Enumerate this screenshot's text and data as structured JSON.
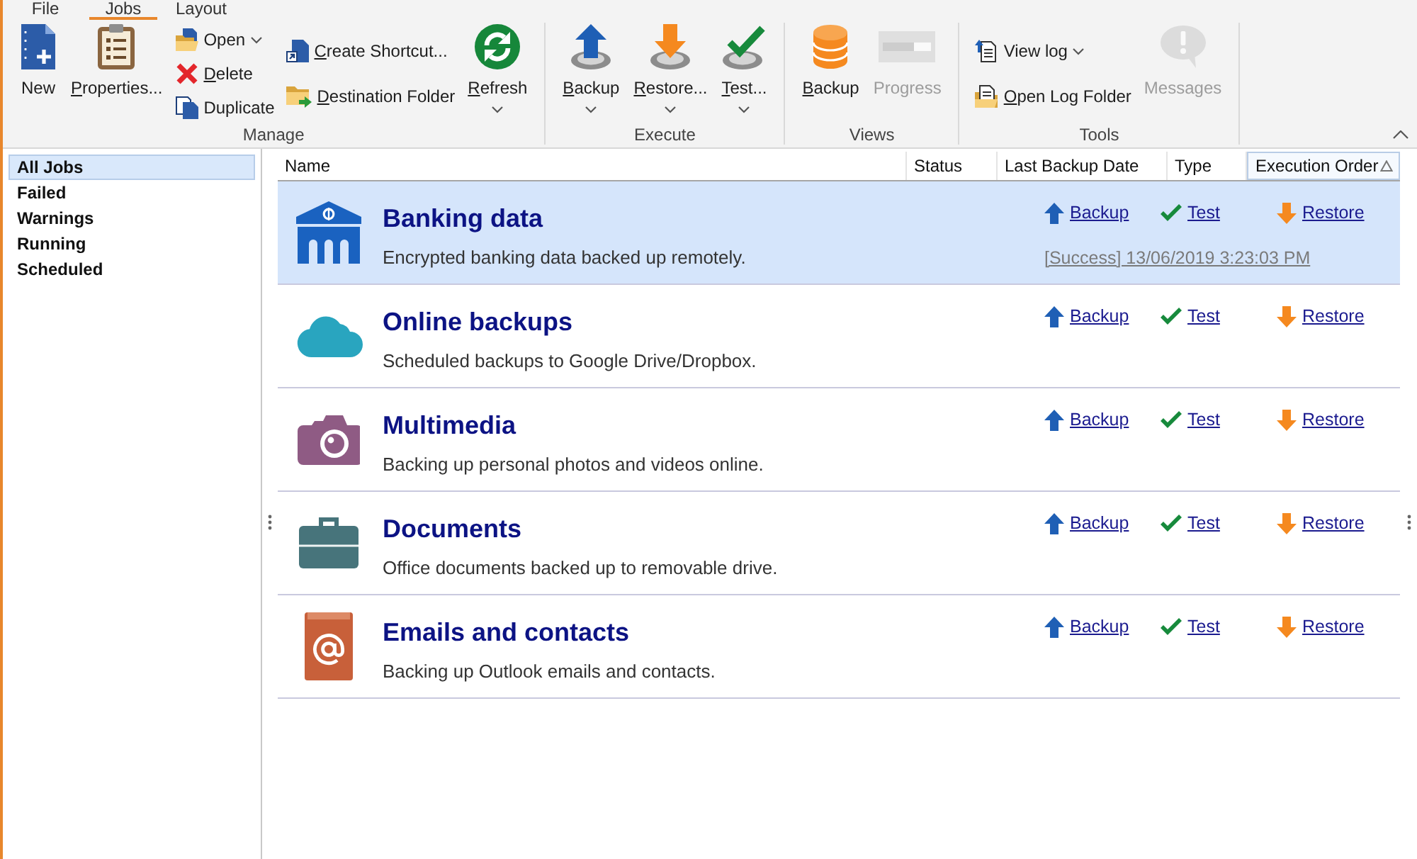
{
  "tabs": [
    {
      "label": "File",
      "selected": false
    },
    {
      "label": "Jobs",
      "selected": true
    },
    {
      "label": "Layout",
      "selected": false
    }
  ],
  "ribbon": {
    "groups": [
      {
        "label": "Manage",
        "columns": [
          {
            "buttons": [
              {
                "kind": "new",
                "label": "New",
                "mnemonic": false,
                "dropdown": false,
                "disabled": false
              }
            ]
          },
          {
            "buttons": [
              {
                "kind": "properties",
                "label": "Properties...",
                "mnemonic": true,
                "dropdown": false,
                "disabled": false
              }
            ]
          },
          {
            "buttons": [
              {
                "kind": "open",
                "label": "Open",
                "mnemonic": false,
                "dropdown": true,
                "disabled": false
              },
              {
                "kind": "delete",
                "label": "Delete",
                "mnemonic": true,
                "dropdown": false,
                "disabled": false
              },
              {
                "kind": "duplicate",
                "label": "Duplicate",
                "mnemonic": false,
                "dropdown": false,
                "disabled": false
              }
            ]
          },
          {
            "buttons": [
              {
                "kind": "shortcut",
                "label": "Create Shortcut...",
                "mnemonic": true,
                "dropdown": false,
                "disabled": false
              },
              {
                "kind": "destination",
                "label": "Destination Folder",
                "mnemonic": true,
                "dropdown": false,
                "disabled": false
              }
            ]
          },
          {
            "buttons": [
              {
                "kind": "refresh",
                "label": "Refresh",
                "mnemonic": true,
                "dropdown": true,
                "disabled": false
              }
            ]
          }
        ]
      },
      {
        "label": "Execute",
        "columns": [
          {
            "buttons": [
              {
                "kind": "backup",
                "label": "Backup",
                "mnemonic": true,
                "dropdown": true,
                "disabled": false
              }
            ]
          },
          {
            "buttons": [
              {
                "kind": "restore",
                "label": "Restore...",
                "mnemonic": true,
                "dropdown": true,
                "disabled": false
              }
            ]
          },
          {
            "buttons": [
              {
                "kind": "test",
                "label": "Test...",
                "mnemonic": true,
                "dropdown": true,
                "disabled": false
              }
            ]
          }
        ]
      },
      {
        "label": "Views",
        "columns": [
          {
            "buttons": [
              {
                "kind": "database",
                "label": "Backup",
                "mnemonic": true,
                "dropdown": false,
                "disabled": false
              }
            ]
          },
          {
            "buttons": [
              {
                "kind": "progress",
                "label": "Progress",
                "mnemonic": false,
                "dropdown": false,
                "disabled": true
              }
            ]
          }
        ]
      },
      {
        "label": "Tools",
        "columns": [
          {
            "buttons": [
              {
                "kind": "viewlog",
                "label": "View log",
                "mnemonic": false,
                "dropdown": true,
                "disabled": false
              },
              {
                "kind": "logfolder",
                "label": "Open Log Folder",
                "mnemonic": true,
                "dropdown": false,
                "disabled": false
              }
            ]
          },
          {
            "buttons": [
              {
                "kind": "messages",
                "label": "Messages",
                "mnemonic": false,
                "dropdown": false,
                "disabled": true
              }
            ]
          }
        ]
      }
    ]
  },
  "sidebar": {
    "items": [
      {
        "label": "All Jobs",
        "selected": true
      },
      {
        "label": "Failed",
        "selected": false
      },
      {
        "label": "Warnings",
        "selected": false
      },
      {
        "label": "Running",
        "selected": false
      },
      {
        "label": "Scheduled",
        "selected": false
      }
    ]
  },
  "table": {
    "columns": [
      {
        "label": "Name",
        "sorted": false
      },
      {
        "label": "Status",
        "sorted": false
      },
      {
        "label": "Last Backup Date",
        "sorted": false
      },
      {
        "label": "Type",
        "sorted": false
      },
      {
        "label": "Execution Order",
        "sorted": true
      }
    ],
    "rows": [
      {
        "kind": "bank",
        "name": "Banking data",
        "description": "Encrypted banking data backed up remotely.",
        "selected": true,
        "actions": [
          {
            "kind": "backup",
            "label": "Backup"
          },
          {
            "kind": "test",
            "label": "Test"
          },
          {
            "kind": "restore",
            "label": "Restore"
          }
        ],
        "last_result": "[Success] 13/06/2019 3:23:03 PM"
      },
      {
        "kind": "cloud",
        "name": "Online backups",
        "description": "Scheduled backups to Google Drive/Dropbox.",
        "selected": false,
        "actions": [
          {
            "kind": "backup",
            "label": "Backup"
          },
          {
            "kind": "test",
            "label": "Test"
          },
          {
            "kind": "restore",
            "label": "Restore"
          }
        ]
      },
      {
        "kind": "camera",
        "name": "Multimedia",
        "description": "Backing up personal photos and videos online.",
        "selected": false,
        "actions": [
          {
            "kind": "backup",
            "label": "Backup"
          },
          {
            "kind": "test",
            "label": "Test"
          },
          {
            "kind": "restore",
            "label": "Restore"
          }
        ]
      },
      {
        "kind": "briefcase",
        "name": "Documents",
        "description": "Office documents backed up to removable drive.",
        "selected": false,
        "actions": [
          {
            "kind": "backup",
            "label": "Backup"
          },
          {
            "kind": "test",
            "label": "Test"
          },
          {
            "kind": "restore",
            "label": "Restore"
          }
        ]
      },
      {
        "kind": "addressbook",
        "name": "Emails and contacts",
        "description": "Backing up Outlook emails and contacts.",
        "selected": false,
        "actions": [
          {
            "kind": "backup",
            "label": "Backup"
          },
          {
            "kind": "test",
            "label": "Test"
          },
          {
            "kind": "restore",
            "label": "Restore"
          }
        ]
      }
    ]
  }
}
